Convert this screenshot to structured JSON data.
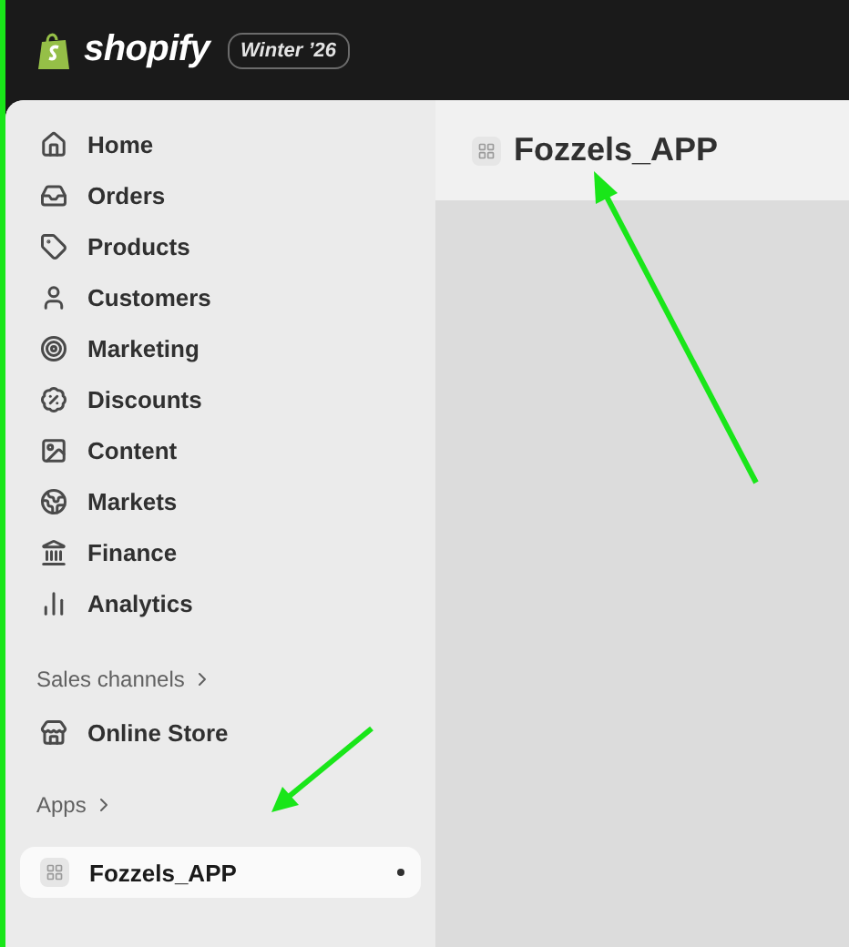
{
  "top_bar": {
    "brand": "shopify",
    "badge": "Winter ’26"
  },
  "sidebar": {
    "items": [
      {
        "label": "Home",
        "selected": false
      },
      {
        "label": "Orders",
        "selected": false
      },
      {
        "label": "Products",
        "selected": false
      },
      {
        "label": "Customers",
        "selected": false
      },
      {
        "label": "Marketing",
        "selected": false
      },
      {
        "label": "Discounts",
        "selected": false
      },
      {
        "label": "Content",
        "selected": false
      },
      {
        "label": "Markets",
        "selected": false
      },
      {
        "label": "Finance",
        "selected": false
      },
      {
        "label": "Analytics",
        "selected": false
      }
    ],
    "sections": [
      {
        "heading": "Sales channels",
        "items": [
          {
            "label": "Online Store",
            "selected": false
          }
        ]
      },
      {
        "heading": "Apps",
        "items": [
          {
            "label": "Fozzels_APP",
            "selected": true
          }
        ]
      }
    ]
  },
  "page": {
    "title": "Fozzels_APP"
  }
}
